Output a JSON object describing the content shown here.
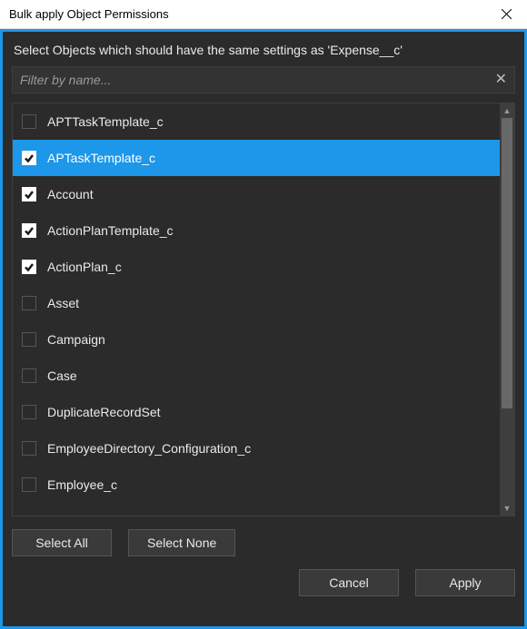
{
  "window": {
    "title": "Bulk apply Object Permissions"
  },
  "instruction": "Select Objects which should have the same settings as 'Expense__c'",
  "filter": {
    "placeholder": "Filter by name...",
    "value": ""
  },
  "objects": [
    {
      "label": "APTTaskTemplate_c",
      "checked": false,
      "selected": false
    },
    {
      "label": "APTaskTemplate_c",
      "checked": true,
      "selected": true
    },
    {
      "label": "Account",
      "checked": true,
      "selected": false
    },
    {
      "label": "ActionPlanTemplate_c",
      "checked": true,
      "selected": false
    },
    {
      "label": "ActionPlan_c",
      "checked": true,
      "selected": false
    },
    {
      "label": "Asset",
      "checked": false,
      "selected": false
    },
    {
      "label": "Campaign",
      "checked": false,
      "selected": false
    },
    {
      "label": "Case",
      "checked": false,
      "selected": false
    },
    {
      "label": "DuplicateRecordSet",
      "checked": false,
      "selected": false
    },
    {
      "label": "EmployeeDirectory_Configuration_c",
      "checked": false,
      "selected": false
    },
    {
      "label": "Employee_c",
      "checked": false,
      "selected": false
    }
  ],
  "buttons": {
    "select_all": "Select All",
    "select_none": "Select None",
    "cancel": "Cancel",
    "apply": "Apply"
  }
}
